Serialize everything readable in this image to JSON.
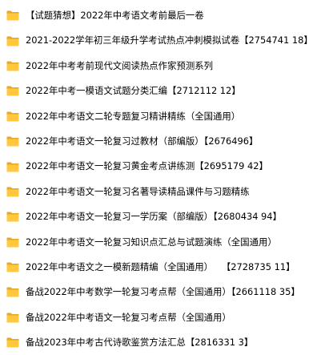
{
  "folder_icon": {
    "name": "folder-icon",
    "colors": {
      "back": "#e8a825",
      "front": "#ffc83d",
      "tab": "#e8a825"
    }
  },
  "folders": [
    {
      "name": "【试题猜想】2022年中考语文考前最后一卷"
    },
    {
      "name": "2021-2022学年初三年级升学考试热点冲刺模拟试卷【2754741 18】"
    },
    {
      "name": "2022年中考考前现代文阅读热点作家预测系列"
    },
    {
      "name": "2022年中考一模语文试题分类汇编【2712112 12】"
    },
    {
      "name": "2022年中考语文二轮专题复习精讲精练（全国通用）"
    },
    {
      "name": "2022年中考语文一轮复习过教材（部编版）【2676496】"
    },
    {
      "name": "2022年中考语文一轮复习黄金考点讲练测【2695179 42】"
    },
    {
      "name": "2022年中考语文一轮复习名著导读精品课件与习题精练"
    },
    {
      "name": "2022年中考语文一轮复习一学历案（部编版）【2680434 94】"
    },
    {
      "name": "2022年中考语文一轮复习知识点汇总与试题演练（全国通用）"
    },
    {
      "name": "2022年中考语文之一模新题精编（全国通用）   【2728735 11】"
    },
    {
      "name": "备战2022年中考数学一轮复习考点帮（全国通用）【2661118 35】"
    },
    {
      "name": "备战2022年中考语文一轮复习考点帮（全国通用）"
    },
    {
      "name": "备战2023年中考古代诗歌鉴赏方法汇总【2816331 3】"
    }
  ]
}
